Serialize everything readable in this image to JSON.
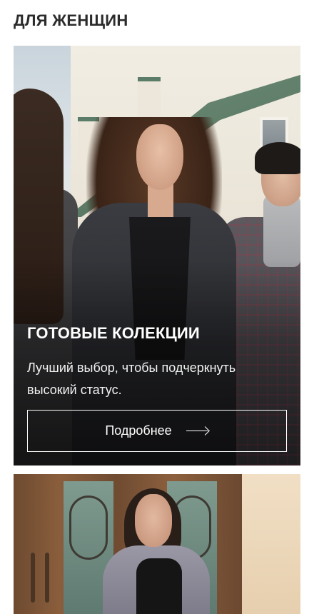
{
  "section": {
    "title": "ДЛЯ ЖЕНЩИН"
  },
  "cards": [
    {
      "title": "ГОТОВЫЕ КОЛЕКЦИИ",
      "description": "Лучший выбор, чтобы подчеркнуть высокий статус.",
      "button_label": "Подробнее",
      "button_icon": "arrow-right-icon"
    },
    {}
  ],
  "colors": {
    "text_dark": "#2b2b2b",
    "overlay_text": "#ffffff",
    "background": "#ffffff"
  }
}
